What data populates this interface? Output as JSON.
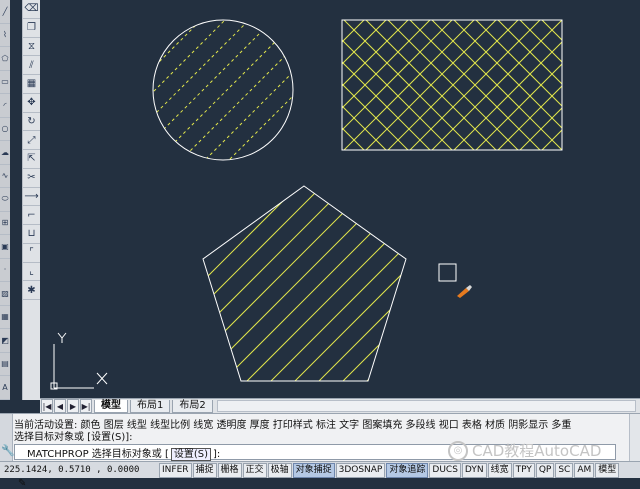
{
  "toolbar_left": {
    "icons": [
      "line-icon",
      "polyline-icon",
      "polygon-icon",
      "rectangle-icon",
      "arc-icon",
      "circle-icon",
      "revcloud-icon",
      "spline-icon",
      "ellipse-icon",
      "insert-icon",
      "block-icon",
      "point-icon",
      "hatch-icon",
      "gradient-icon",
      "region-icon",
      "table-icon",
      "text-icon"
    ],
    "bottom_glyph": "A"
  },
  "toolbar_modify": {
    "icons": [
      "erase-icon",
      "copy-icon",
      "mirror-icon",
      "offset-icon",
      "array-icon",
      "move-icon",
      "rotate-icon",
      "scale-icon",
      "stretch-icon",
      "trim-icon",
      "extend-icon",
      "break-icon",
      "join-icon",
      "chamfer-icon",
      "fillet-icon",
      "explode-icon"
    ]
  },
  "drawing": {
    "colors": {
      "background": "#233040",
      "outline": "#ffffff",
      "hatch": "#e1e54b",
      "cursor": "#ffffff"
    },
    "ucs": {
      "y_label": "Y",
      "x_label": "X"
    }
  },
  "layout_tabs": {
    "nav": [
      "|◀",
      "◀",
      "▶",
      "▶|"
    ],
    "tabs": [
      "模型",
      "布局1",
      "布局2"
    ],
    "active": "模型"
  },
  "command": {
    "line1": "当前活动设置: 颜色 图层 线型 线型比例 线宽 透明度 厚度 打印样式 标注 文字 图案填充 多段线 视口 表格 材质 阴影显示 多重",
    "line2": "选择目标对象或 [设置(S)]:",
    "prompt_cmd": "MATCHPROP 选择目标对象或 [",
    "prompt_opt": "设置(S)",
    "prompt_end": "]:"
  },
  "status_bar": {
    "coords": "225.1424, 0.5710 , 0.0000",
    "buttons": [
      {
        "label": "INFER",
        "on": false
      },
      {
        "label": "捕捉",
        "on": false
      },
      {
        "label": "栅格",
        "on": false
      },
      {
        "label": "正交",
        "on": false
      },
      {
        "label": "极轴",
        "on": false
      },
      {
        "label": "对象捕捉",
        "on": true
      },
      {
        "label": "3DOSNAP",
        "on": false
      },
      {
        "label": "对象追踪",
        "on": true
      },
      {
        "label": "DUCS",
        "on": false
      },
      {
        "label": "DYN",
        "on": false
      },
      {
        "label": "线宽",
        "on": false
      },
      {
        "label": "TPY",
        "on": false
      },
      {
        "label": "QP",
        "on": false
      },
      {
        "label": "SC",
        "on": false
      },
      {
        "label": "AM",
        "on": false
      },
      {
        "label": "模型",
        "on": false
      }
    ]
  },
  "watermark": {
    "text": "CAD教程AutoCAD"
  }
}
